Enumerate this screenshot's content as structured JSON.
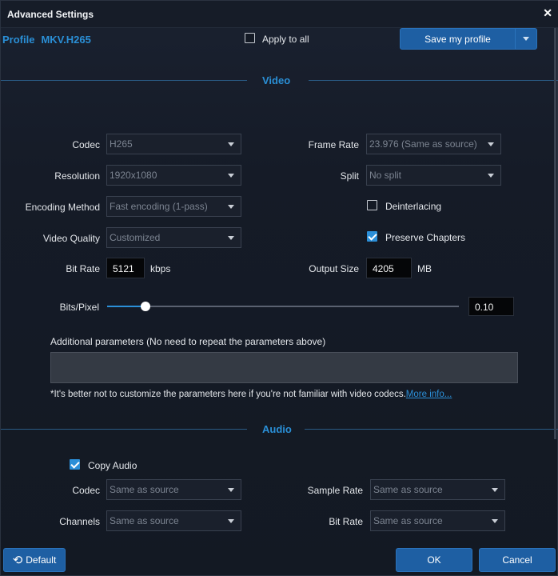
{
  "window": {
    "title": "Advanced Settings",
    "close_icon": "close-icon"
  },
  "profile": {
    "label": "Profile",
    "name": "MKV.H265"
  },
  "apply_to_all": {
    "label": "Apply to all",
    "checked": false
  },
  "save_profile": {
    "label": "Save my profile",
    "dropdown_icon": "chevron-down-icon"
  },
  "video": {
    "section_title": "Video",
    "codec": {
      "label": "Codec",
      "value": "H265"
    },
    "resolution": {
      "label": "Resolution",
      "value": "1920x1080"
    },
    "encoding_method": {
      "label": "Encoding Method",
      "value": "Fast encoding (1-pass)"
    },
    "video_quality": {
      "label": "Video Quality",
      "value": "Customized"
    },
    "bit_rate": {
      "label": "Bit Rate",
      "value": "5121",
      "unit": "kbps"
    },
    "frame_rate": {
      "label": "Frame Rate",
      "value": "23.976 (Same as source)"
    },
    "split": {
      "label": "Split",
      "value": "No split"
    },
    "deinterlacing": {
      "label": "Deinterlacing",
      "checked": false
    },
    "preserve_chapters": {
      "label": "Preserve Chapters",
      "checked": true
    },
    "output_size": {
      "label": "Output Size",
      "value": "4205",
      "unit": "MB"
    },
    "bits_pixel": {
      "label": "Bits/Pixel",
      "value": "0.10",
      "slider_fraction": 0.11
    },
    "additional": {
      "label": "Additional parameters (No need to repeat the parameters above)",
      "value": ""
    },
    "note": "*It's better not to customize the parameters here if you're not familiar with video codecs.",
    "more_info": "More info..."
  },
  "audio": {
    "section_title": "Audio",
    "copy_audio": {
      "label": "Copy Audio",
      "checked": true
    },
    "codec": {
      "label": "Codec",
      "value": "Same as source"
    },
    "channels": {
      "label": "Channels",
      "value": "Same as source"
    },
    "sample_rate": {
      "label": "Sample Rate",
      "value": "Same as source"
    },
    "bit_rate": {
      "label": "Bit Rate",
      "value": "Same as source"
    }
  },
  "footer": {
    "default_label": "Default",
    "default_icon": "reset-icon",
    "ok_label": "OK",
    "cancel_label": "Cancel"
  },
  "colors": {
    "accent": "#2a8fd6",
    "button": "#1e5fa3",
    "background": "#141a25"
  }
}
